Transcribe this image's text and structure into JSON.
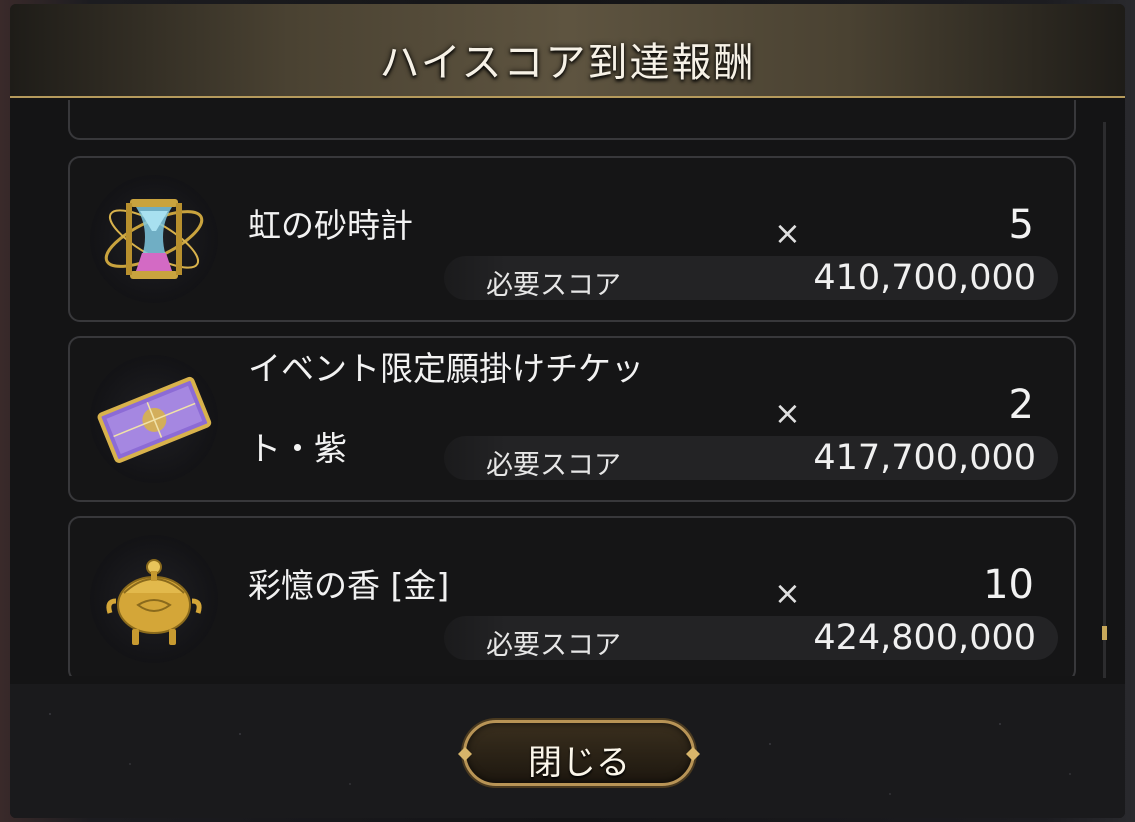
{
  "dialog": {
    "title": "ハイスコア到達報酬",
    "close_label": "閉じる"
  },
  "rewards": [
    {
      "name": "虹の砂時計",
      "icon": "rainbow-hourglass-icon",
      "qty_prefix": "×",
      "qty": "5",
      "score_label": "必要スコア",
      "score": "410,700,000"
    },
    {
      "name_line1": "イベント限定願掛けチケッ",
      "name_line2": "ト・紫",
      "icon": "purple-ticket-icon",
      "qty_prefix": "×",
      "qty": "2",
      "score_label": "必要スコア",
      "score": "417,700,000"
    },
    {
      "name": "彩憶の香 [金]",
      "icon": "gold-incense-burner-icon",
      "qty_prefix": "×",
      "qty": "10",
      "score_label": "必要スコア",
      "score": "424,800,000"
    }
  ],
  "colors": {
    "gold_accent": "#b89456",
    "card_border": "#38383b",
    "panel_bg": "#141415"
  }
}
